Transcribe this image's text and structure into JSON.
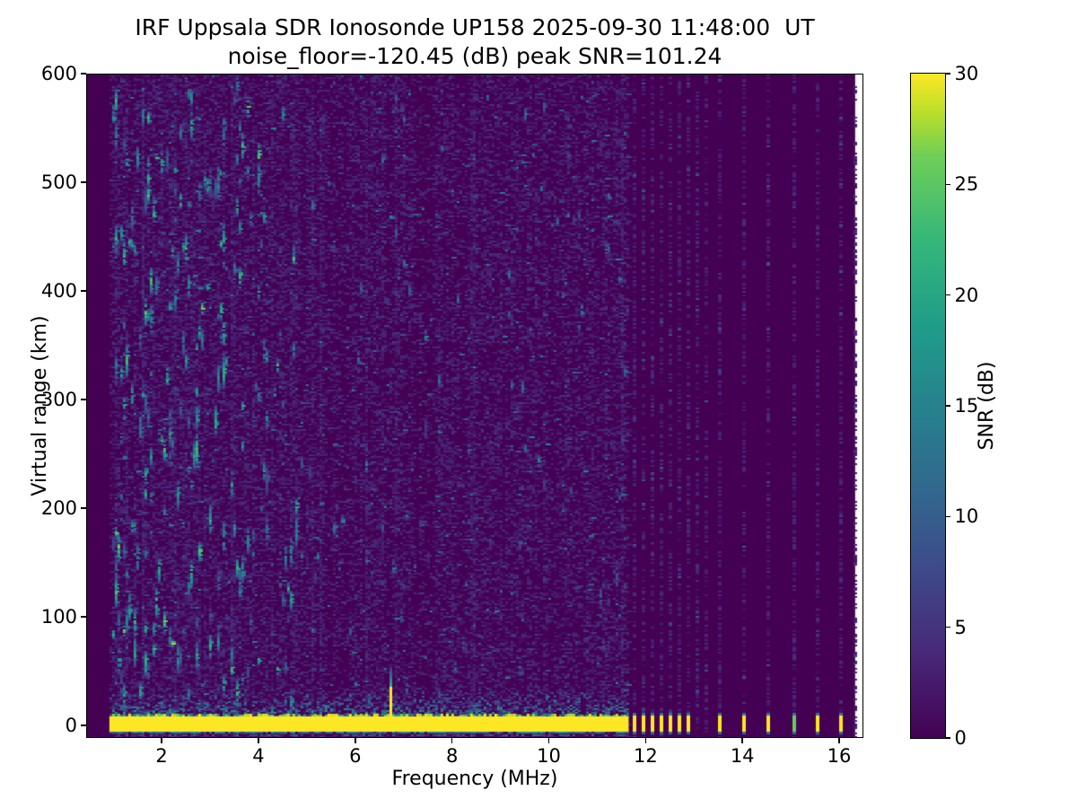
{
  "title": {
    "line1": "IRF Uppsala SDR Ionosonde UP158 2025-09-30 11:48:00  UT",
    "line2": "noise_floor=-120.45 (dB) peak SNR=101.24"
  },
  "chart_data": {
    "type": "heatmap",
    "title": "IRF Uppsala SDR Ionosonde UP158 2025-09-30 11:48:00  UT",
    "subtitle": "noise_floor=-120.45 (dB) peak SNR=101.24",
    "station": "UP158",
    "timestamp_ut": "2025-09-30 11:48:00",
    "noise_floor_db": -120.45,
    "peak_snr_db": 101.24,
    "xlabel": "Frequency (MHz)",
    "ylabel": "Virtual range (km)",
    "xlim": [
      0.44,
      16.5
    ],
    "ylim": [
      -11.6,
      600
    ],
    "xticks": [
      2,
      4,
      6,
      8,
      10,
      12,
      14,
      16
    ],
    "yticks": [
      0,
      100,
      200,
      300,
      400,
      500,
      600
    ],
    "grid": false,
    "colorbar": {
      "label": "SNR (dB)",
      "vmin": 0,
      "vmax": 30,
      "ticks": [
        0,
        5,
        10,
        15,
        20,
        25,
        30
      ],
      "colormap": "viridis"
    },
    "colormap_stops": [
      [
        0.0,
        "#440154"
      ],
      [
        0.125,
        "#482878"
      ],
      [
        0.25,
        "#3e4989"
      ],
      [
        0.375,
        "#31688e"
      ],
      [
        0.5,
        "#26828e"
      ],
      [
        0.625,
        "#1f9e89"
      ],
      [
        0.75,
        "#35b779"
      ],
      [
        0.875,
        "#6ece58"
      ],
      [
        0.9375,
        "#b5de2b"
      ],
      [
        1.0,
        "#fde725"
      ]
    ],
    "heatmap_model": {
      "seed": 42,
      "data_extent_mhz": [
        0.92,
        16.33
      ],
      "continuous_max_mhz": 11.65,
      "ground_band": {
        "km": [
          -5.5,
          8
        ],
        "snr_db": 30,
        "start_mhz": 0.92
      },
      "low_altitude_noise_km": [
        9,
        34
      ],
      "interference_mhz": 6.7,
      "interference_yellow_top_km": 37,
      "interference_teal_top_km": 55,
      "echo_dense_region_mhz": [
        1.0,
        4.8
      ],
      "echo_streak_count_dense": 250,
      "echo_streak_count_sparse": 95,
      "discrete_cluster_mhz": {
        "start": 11.74,
        "step": 0.185,
        "count": 9,
        "bars_with_ground_echo": 7
      },
      "discrete_sparse_mhz": [
        13.5,
        14.0,
        14.5,
        15.03,
        15.52,
        16.0,
        16.3
      ],
      "sparse_bar_snr_db": [
        30,
        30,
        30,
        26,
        30,
        30,
        0
      ]
    }
  }
}
